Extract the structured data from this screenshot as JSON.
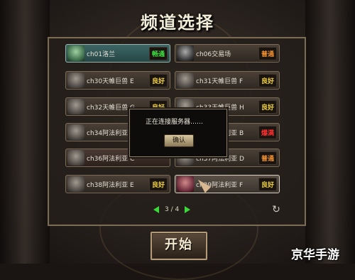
{
  "title": "频道选择",
  "channels": [
    {
      "name": "ch01洛兰",
      "status": "畅通",
      "status_kind": "smooth",
      "avatar": "green-ghost-icon"
    },
    {
      "name": "ch06交易场",
      "status": "普通",
      "status_kind": "normal",
      "avatar": "merchant-icon"
    },
    {
      "name": "ch30天帷巨兽 E",
      "status": "良好",
      "status_kind": "good",
      "avatar": "ghost-icon"
    },
    {
      "name": "ch31天帷巨兽 F",
      "status": "良好",
      "status_kind": "good",
      "avatar": "ghost-icon"
    },
    {
      "name": "ch32天帷巨兽 G",
      "status": "良好",
      "status_kind": "good",
      "avatar": "ghost-icon"
    },
    {
      "name": "ch33天帷巨兽 H",
      "status": "良好",
      "status_kind": "good",
      "avatar": "ghost-icon"
    },
    {
      "name": "ch34阿法利亚 A",
      "status": "",
      "status_kind": "good",
      "avatar": "ghost-icon"
    },
    {
      "name": "ch35阿法利亚 B",
      "status": "爆满",
      "status_kind": "full",
      "avatar": "ghost-icon"
    },
    {
      "name": "ch36阿法利亚 C",
      "status": "",
      "status_kind": "full",
      "avatar": "ghost-icon"
    },
    {
      "name": "ch37阿法利亚 D",
      "status": "普通",
      "status_kind": "normal",
      "avatar": "ghost-icon"
    },
    {
      "name": "ch38阿法利亚 E",
      "status": "良好",
      "status_kind": "good",
      "avatar": "ghost-icon"
    },
    {
      "name": "ch39阿法利亚 F",
      "status": "良好",
      "status_kind": "good",
      "avatar": "red-ghost-icon"
    }
  ],
  "pager": {
    "text": "3 / 4"
  },
  "dialog": {
    "message": "正在连接服务器……",
    "confirm_label": "确认"
  },
  "start_label": "开始",
  "watermark": "京华手游",
  "colors": {
    "good": "#f0d040",
    "smooth": "#40e040",
    "normal": "#f09030",
    "full": "#ff3030",
    "arrow": "#3ad83a"
  }
}
